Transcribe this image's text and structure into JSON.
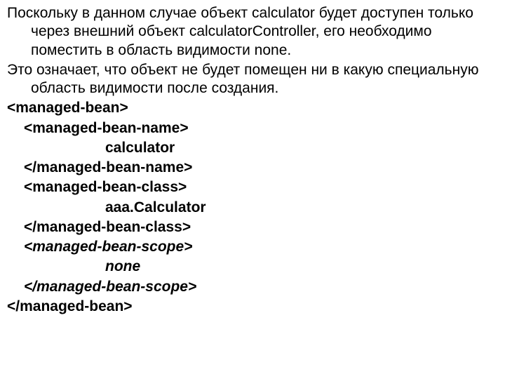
{
  "paragraphs": [
    "Поскольку в данном случае объект calculator будет доступен только через внешний объект calculatorController, его необходимо поместить в область видимости none.",
    "Это означает, что объект не будет помещен ни в какую специальную область видимости после создания."
  ],
  "code": {
    "l1": "<managed-bean>",
    "l2": "<managed-bean-name>",
    "l3": "calculator",
    "l4": "</managed-bean-name>",
    "l5": "<managed-bean-class>",
    "l6": "aaa.Calculator",
    "l7": "</managed-bean-class>",
    "l8": "<managed-bean-scope>",
    "l9": "none",
    "l10": "</managed-bean-scope>",
    "l11": "</managed-bean>"
  }
}
